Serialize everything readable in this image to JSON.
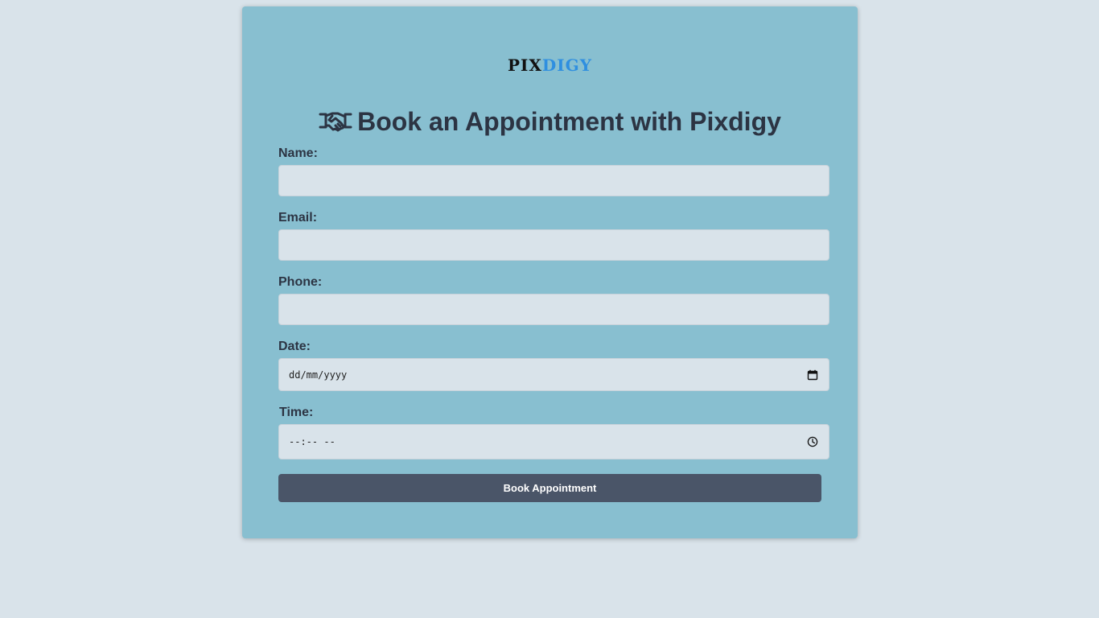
{
  "logo": {
    "part1": "PIX",
    "part2": "DIGY",
    "colors": {
      "part1": "#111111",
      "part2": "#2f8fe0"
    }
  },
  "heading": {
    "icon": "handshake-icon",
    "text": "Book an Appointment with Pixdigy"
  },
  "form": {
    "name_label": "Name:",
    "name_value": "",
    "email_label": "Email:",
    "email_value": "",
    "phone_label": "Phone:",
    "phone_value": "",
    "date_label": "Date:",
    "date_placeholder": "dd/mm/yyyy",
    "date_icon": "calendar-icon",
    "time_label": "Time:",
    "time_placeholder": "--:-- --",
    "time_icon": "clock-icon",
    "submit_label": "Book Appointment"
  },
  "colors": {
    "page_background": "#d9e3ea",
    "card_background": "#88bfd0",
    "input_background": "#d9e3ea",
    "text": "#2c3443",
    "button_background": "#4a5568",
    "button_text": "#ffffff"
  }
}
